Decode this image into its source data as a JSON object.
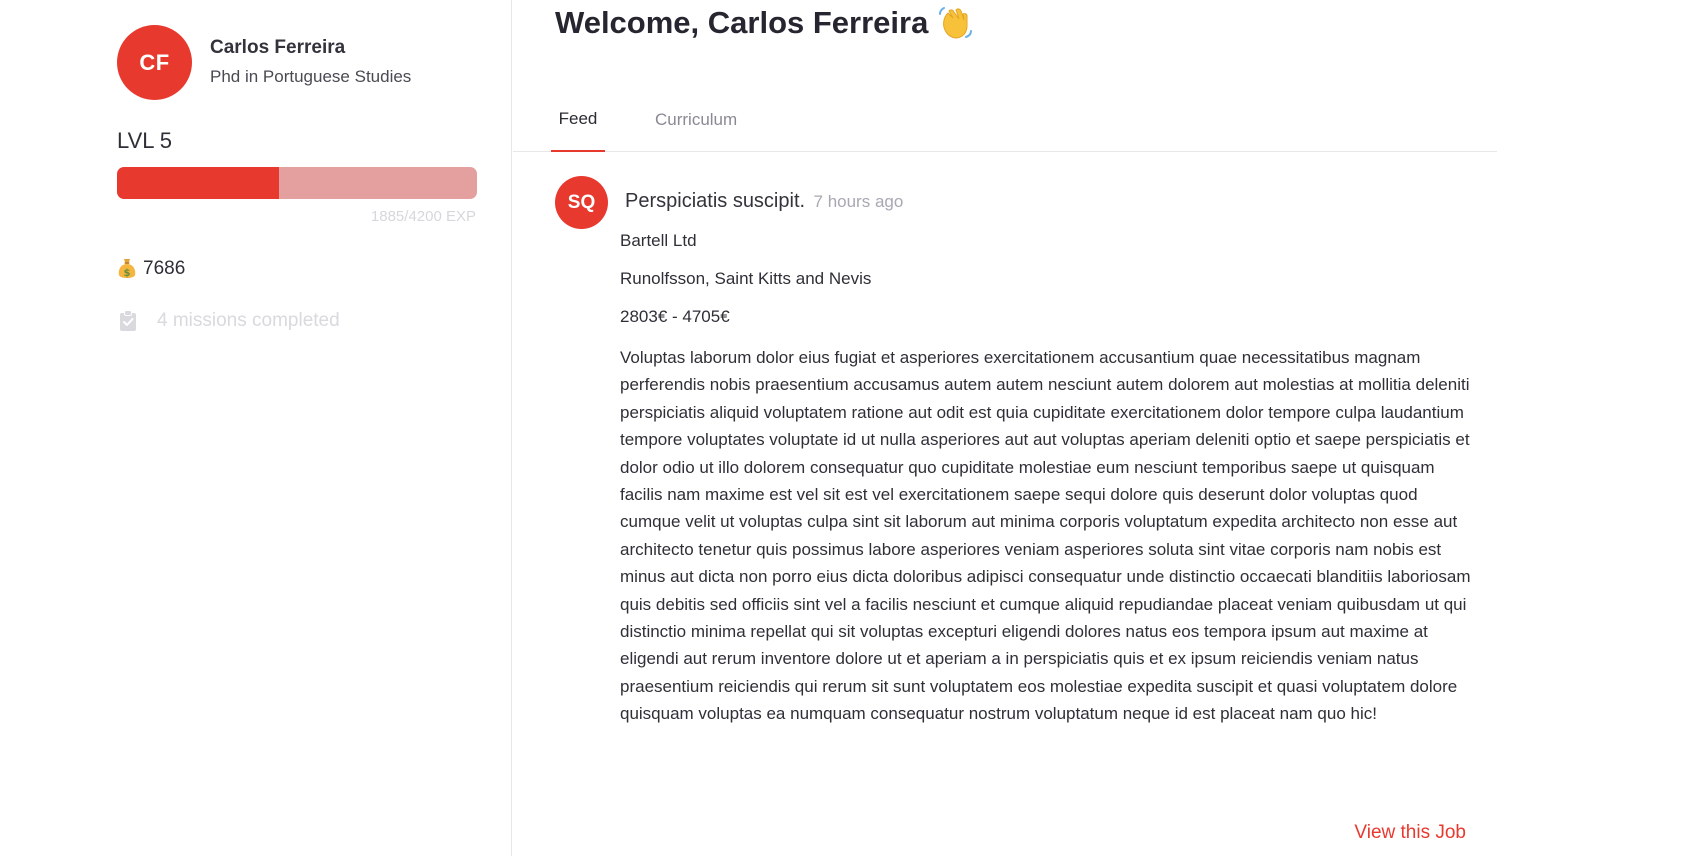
{
  "user": {
    "initials": "CF",
    "name": "Carlos Ferreira",
    "degree": "Phd in Portuguese Studies",
    "level_label": "LVL 5",
    "exp_text": "1885/4200 EXP",
    "exp_progress": 0.449,
    "coins": "7686",
    "missions_text": "4 missions completed"
  },
  "colors": {
    "accent": "#e8392f",
    "progress_track": "#e3a09e",
    "muted_text": "#d9d9de"
  },
  "icons": {
    "coins": "money-bag-icon",
    "missions": "clipboard-check-icon",
    "welcome": "waving-hand-icon"
  },
  "welcome": {
    "title": "Welcome, Carlos Ferreira"
  },
  "tabs": [
    {
      "label": "Feed",
      "active": true
    },
    {
      "label": "Curriculum",
      "active": false
    }
  ],
  "post": {
    "initials": "SQ",
    "title": "Perspiciatis suscipit.",
    "time": "7 hours ago",
    "company": "Bartell Ltd",
    "location": "Runolfsson, Saint Kitts and Nevis",
    "salary": "2803€ - 4705€",
    "description": "Voluptas laborum dolor eius fugiat et asperiores exercitationem accusantium quae necessitatibus magnam perferendis nobis praesentium accusamus autem autem nesciunt autem dolorem aut molestias at mollitia deleniti perspiciatis aliquid voluptatem ratione aut odit est quia cupiditate exercitationem dolor tempore culpa laudantium tempore voluptates voluptate id ut nulla asperiores aut aut voluptas aperiam deleniti optio et saepe perspiciatis et dolor odio ut illo dolorem consequatur quo cupiditate molestiae eum nesciunt temporibus saepe ut quisquam facilis nam maxime est vel sit est vel exercitationem saepe sequi dolore quis deserunt dolor voluptas quod cumque velit ut voluptas culpa sint sit laborum aut minima corporis voluptatum expedita architecto non esse aut architecto tenetur quis possimus labore asperiores veniam asperiores soluta sint vitae corporis nam nobis est minus aut dicta non porro eius dicta doloribus adipisci consequatur unde distinctio occaecati blanditiis laboriosam quis debitis sed officiis sint vel a facilis nesciunt et cumque aliquid repudiandae placeat veniam quibusdam ut qui distinctio minima repellat qui sit voluptas excepturi eligendi dolores natus eos tempora ipsum aut maxime at eligendi aut rerum inventore dolore ut et aperiam a in perspiciatis quis et ex ipsum reiciendis veniam natus praesentium reiciendis qui rerum sit sunt voluptatem eos molestiae expedita suscipit et quasi voluptatem dolore quisquam voluptas ea numquam consequatur nostrum voluptatum neque id est placeat nam quo hic!",
    "view_label": "View this Job"
  }
}
